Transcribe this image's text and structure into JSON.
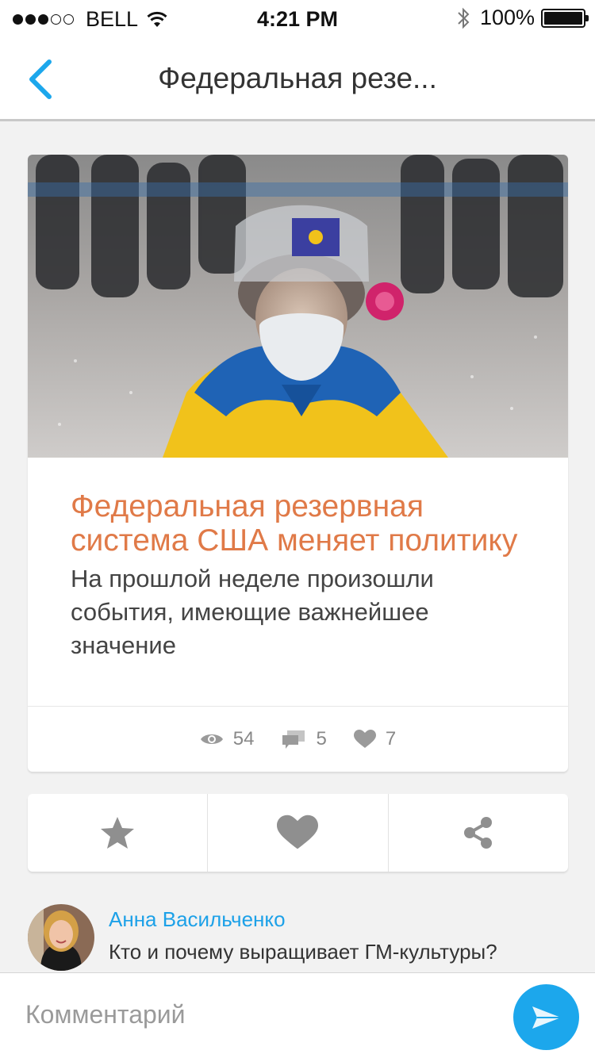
{
  "status_bar": {
    "carrier": "BELL",
    "time": "4:21 PM",
    "battery": "100%",
    "signal_bars_filled": 3,
    "signal_bars_total": 5
  },
  "nav": {
    "title": "Федеральная резе..."
  },
  "article": {
    "headline": "Федеральная резервная система США меняет политику",
    "summary": "На прошлой неделе произошли события, имеющие важнейшее значение",
    "stats": {
      "views": "54",
      "comments": "5",
      "likes": "7"
    }
  },
  "comment": {
    "author": "Анна Васильченко",
    "text": "Кто и почему выращивает ГМ-культуры?"
  },
  "input": {
    "placeholder": "Комментарий"
  },
  "colors": {
    "accent_blue": "#1ca7ec",
    "headline_orange": "#e07a48",
    "author_blue": "#1da1e8",
    "icon_gray": "#9a9a9a"
  }
}
